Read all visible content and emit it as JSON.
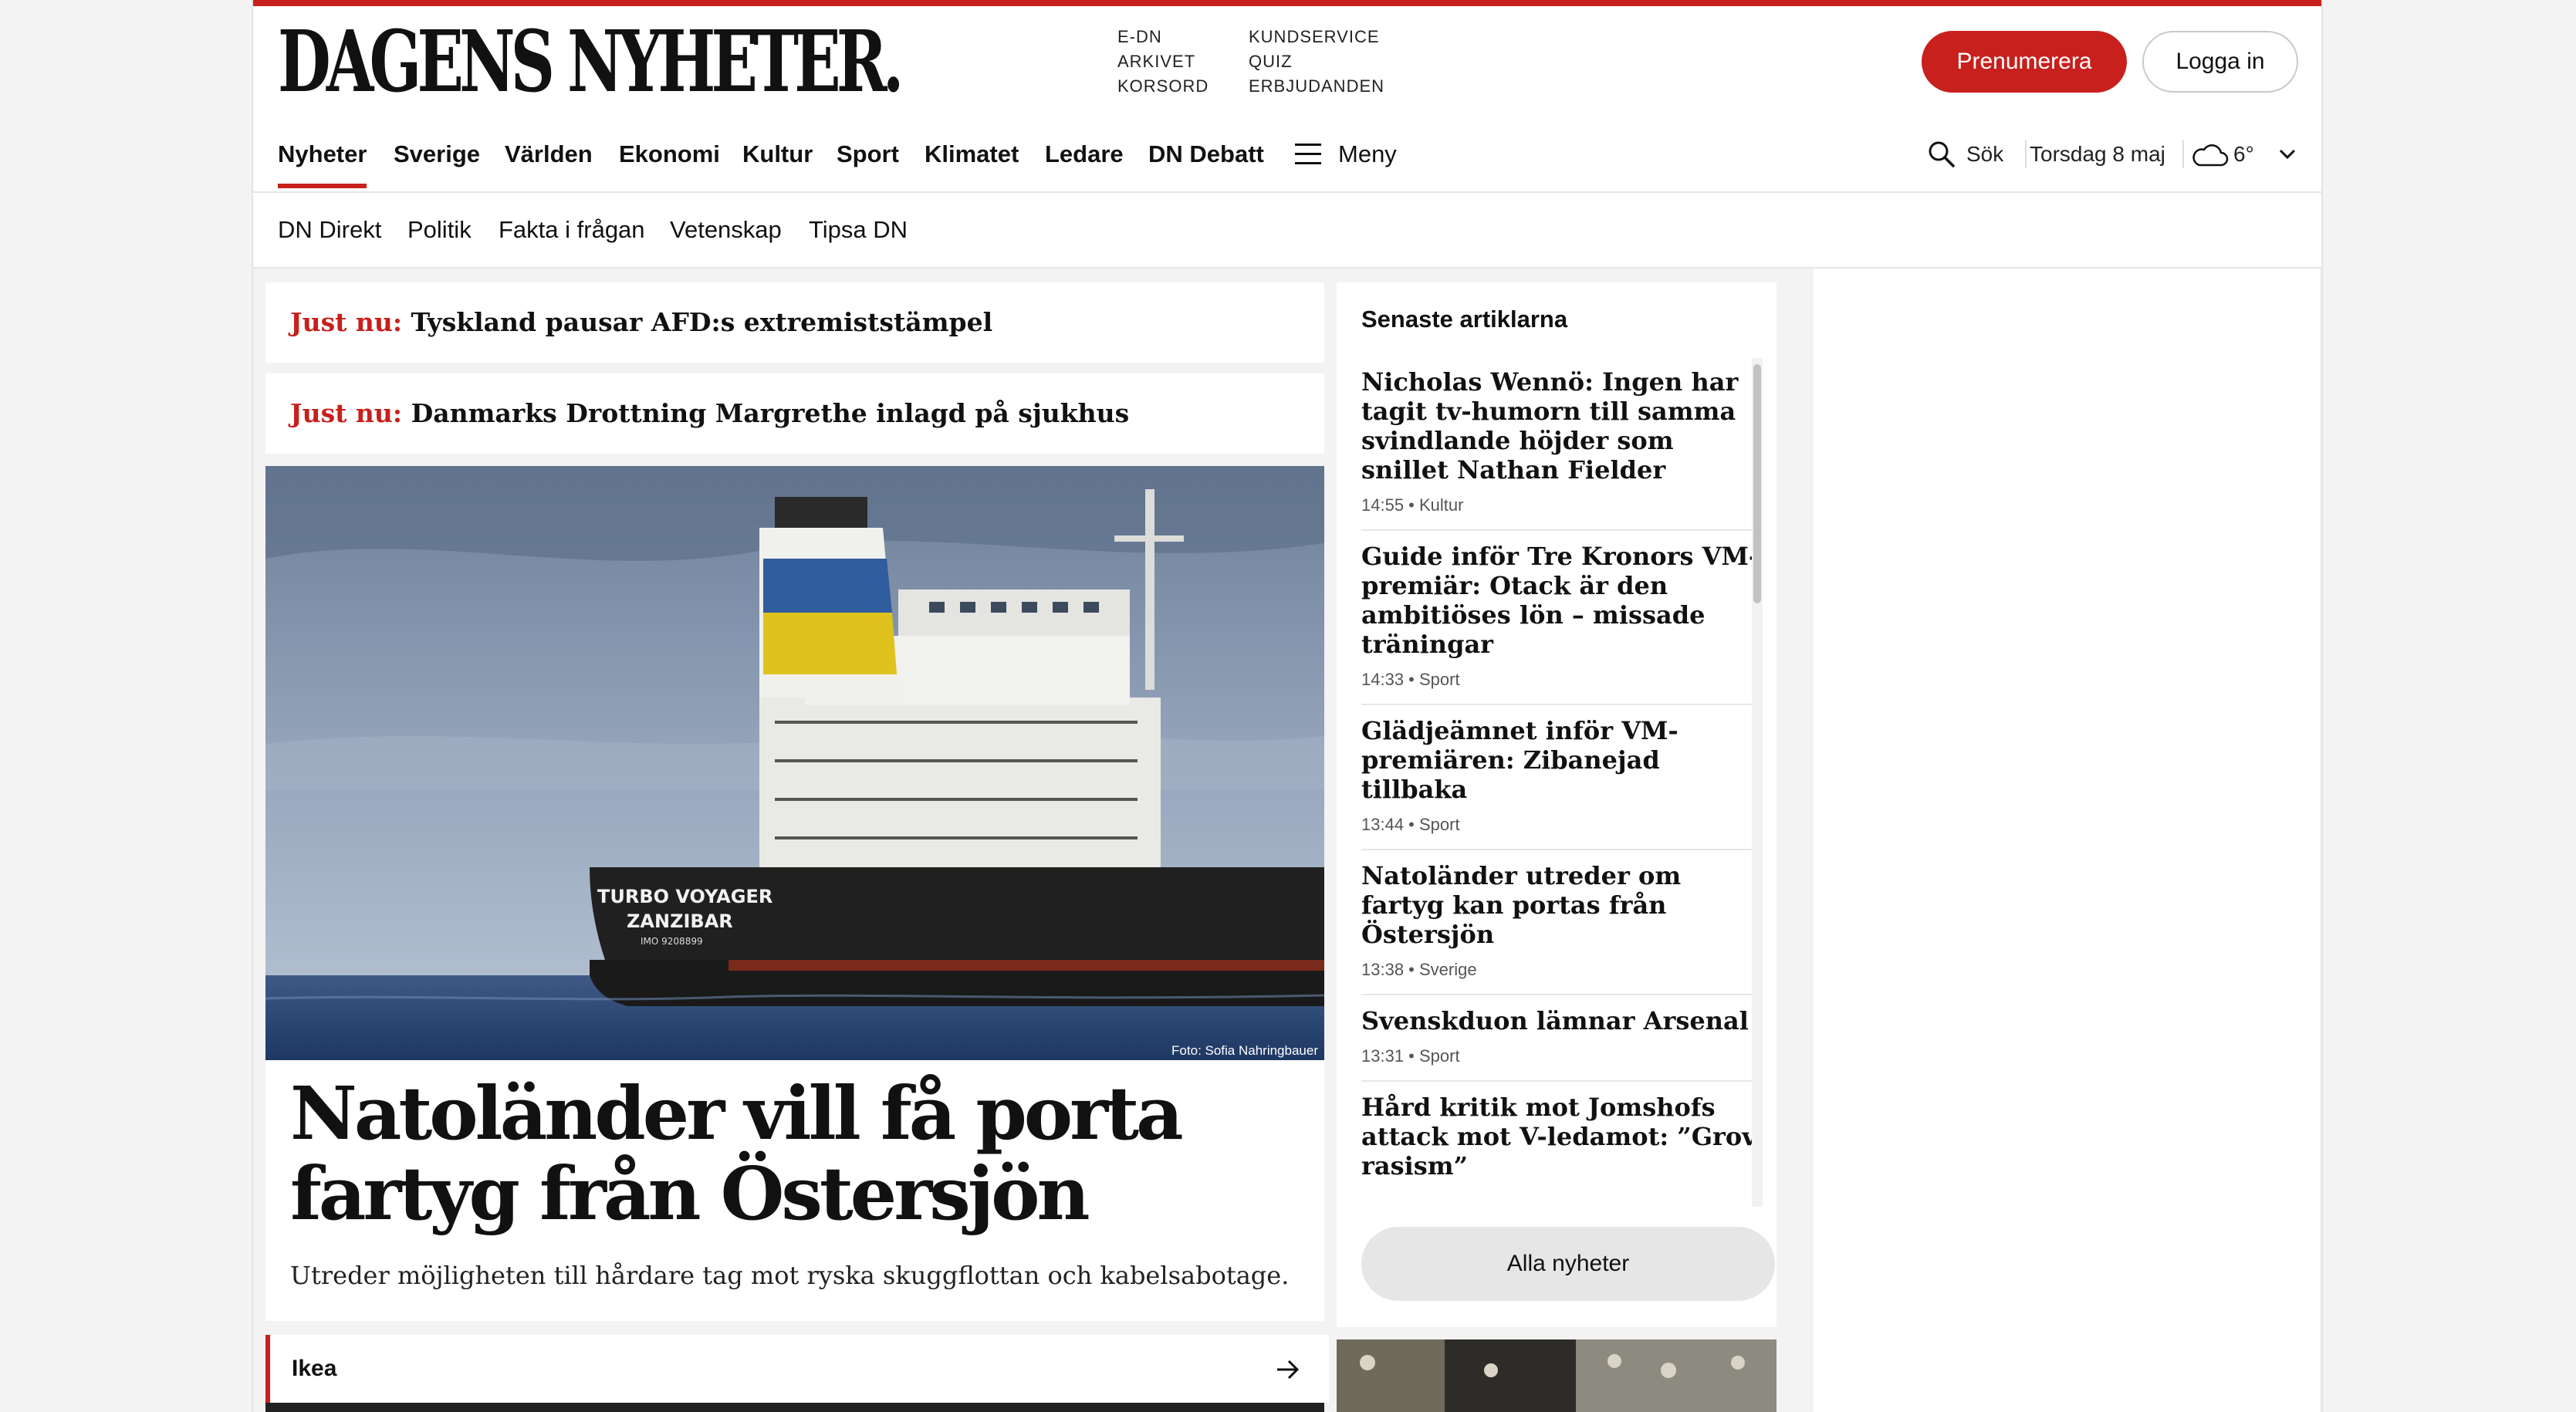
{
  "header": {
    "logo": "DAGENS NYHETER.",
    "quick_links_col1": [
      "E-DN",
      "ARKIVET",
      "KORSORD"
    ],
    "quick_links_col2": [
      "KUNDSERVICE",
      "QUIZ",
      "ERBJUDANDEN"
    ],
    "subscribe_label": "Prenumerera",
    "login_label": "Logga in"
  },
  "nav": {
    "items": [
      "Nyheter",
      "Sverige",
      "Världen",
      "Ekonomi",
      "Kultur",
      "Sport",
      "Klimatet",
      "Ledare",
      "DN Debatt"
    ],
    "active": "Nyheter",
    "menu_label": "Meny",
    "search_label": "Sök",
    "date": "Torsdag 8 maj",
    "weather": "6°"
  },
  "subnav": {
    "items": [
      "DN Direkt",
      "Politik",
      "Fakta i frågan",
      "Vetenskap",
      "Tipsa DN"
    ]
  },
  "breaking": [
    {
      "label": "Just nu:",
      "text": "Tyskland pausar AFD:s extremiststämpel"
    },
    {
      "label": "Just nu:",
      "text": "Danmarks Drottning Margrethe inlagd på sjukhus"
    }
  ],
  "hero": {
    "ship_name_1": "TURBO VOYAGER",
    "ship_name_2": "ZANZIBAR",
    "ship_imo": "IMO 9208899",
    "credit": "Foto: Sofia Nahringbauer",
    "headline": "Natoländer vill få porta fartyg från Östersjön",
    "lead": "Utreder möjligheten till hårdare tag mot ryska skuggflottan och kabelsabotage."
  },
  "section_bar": {
    "label": "Ikea"
  },
  "sidebar": {
    "title": "Senaste artiklarna",
    "articles": [
      {
        "title": "Nicholas Wennö: Ingen har tagit tv-humorn till samma svindlande höjder som snillet Nathan Fielder",
        "meta": "14:55 • Kultur"
      },
      {
        "title": "Guide inför Tre Kronors VM-premiär: Otack är den ambitiöses lön – missade träningar",
        "meta": "14:33 • Sport"
      },
      {
        "title": "Glädjeämnet inför VM-premiären: Zibanejad tillbaka",
        "meta": "13:44 • Sport"
      },
      {
        "title": "Natoländer utreder om fartyg kan portas från Östersjön",
        "meta": "13:38 • Sverige"
      },
      {
        "title": "Svenskduon lämnar Arsenal",
        "meta": "13:31 • Sport"
      },
      {
        "title": "Hård kritik mot Jomshofs attack mot V-ledamot: ”Grov rasism”",
        "meta": ""
      }
    ],
    "all_news_label": "Alla nyheter"
  },
  "colors": {
    "brand_red": "#c7201d",
    "background": "#f3f3f3"
  }
}
